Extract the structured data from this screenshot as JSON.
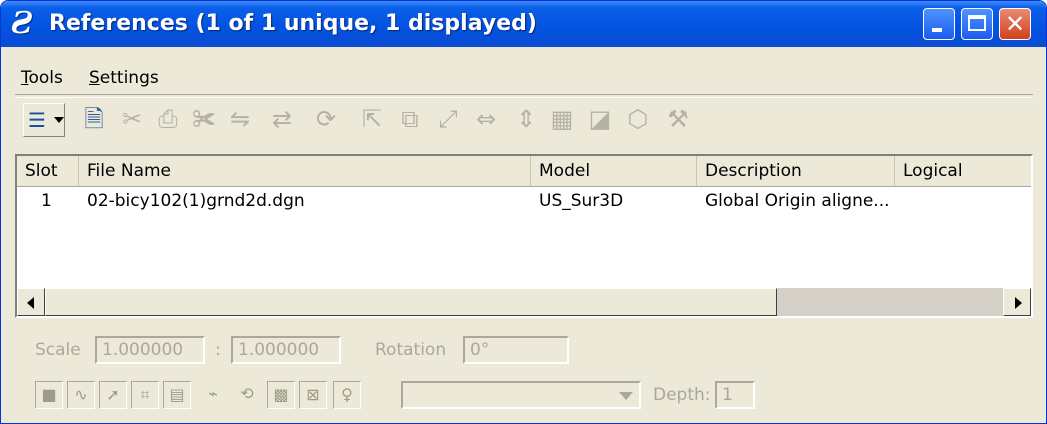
{
  "window": {
    "title": "References (1 of 1 unique, 1 displayed)",
    "app_icon_glyph": "Ƨ",
    "close_glyph": "✕"
  },
  "menu": {
    "items": [
      {
        "label": "Tools"
      },
      {
        "label": "Settings"
      }
    ]
  },
  "toolbar": {
    "list_icon_glyph": "☰",
    "tools": [
      {
        "name": "attach-icon",
        "glyph": "🗎",
        "enabled": true
      },
      {
        "name": "detach-icon",
        "glyph": "✂",
        "enabled": false
      },
      {
        "name": "print-icon",
        "glyph": "⎙",
        "enabled": false
      },
      {
        "name": "clip-icon",
        "glyph": "✀",
        "enabled": false
      },
      {
        "name": "reload-icon",
        "glyph": "⇋",
        "enabled": false
      },
      {
        "name": "exchange-icon",
        "glyph": "⇄",
        "enabled": false
      },
      {
        "name": "rotate-icon",
        "glyph": "⟳",
        "enabled": false
      },
      {
        "name": "move-icon",
        "glyph": "⇱",
        "enabled": false
      },
      {
        "name": "copy-icon",
        "glyph": "⧉",
        "enabled": false
      },
      {
        "name": "scale-icon",
        "glyph": "⤢",
        "enabled": false
      },
      {
        "name": "mirror-h-icon",
        "glyph": "⇔",
        "enabled": false
      },
      {
        "name": "mirror-v-icon",
        "glyph": "⇕",
        "enabled": false
      },
      {
        "name": "clip-boundary-icon",
        "glyph": "▦",
        "enabled": false
      },
      {
        "name": "clip-mask-icon",
        "glyph": "◪",
        "enabled": false
      },
      {
        "name": "set-icon",
        "glyph": "⬡",
        "enabled": false
      },
      {
        "name": "tools-icon",
        "glyph": "⚒",
        "enabled": false
      }
    ]
  },
  "table": {
    "columns": [
      "Slot",
      "File Name",
      "Model",
      "Description",
      "Logical"
    ],
    "rows": [
      {
        "slot": "1",
        "file_name": "02-bicy102(1)grnd2d.dgn",
        "model": "US_Sur3D",
        "description": "Global Origin aligne...",
        "logical": ""
      }
    ]
  },
  "scale": {
    "label": "Scale",
    "value1": "1.000000",
    "separator": ":",
    "value2": "1.000000",
    "rotation_label": "Rotation",
    "rotation_value": "0°"
  },
  "bottom_bar": {
    "icons": [
      {
        "name": "display-toggle-icon",
        "glyph": "■"
      },
      {
        "name": "snap-icon",
        "glyph": "∿"
      },
      {
        "name": "locate-icon",
        "glyph": "➚"
      },
      {
        "name": "treat-as-element-icon",
        "glyph": "⌗"
      },
      {
        "name": "level-icon",
        "glyph": "▤"
      },
      {
        "name": "nesting-icon",
        "glyph": "⌁"
      },
      {
        "name": "live-nesting-icon",
        "glyph": "⟲"
      },
      {
        "name": "raster-icon",
        "glyph": "▩"
      },
      {
        "name": "clip-icon",
        "glyph": "⊠"
      },
      {
        "name": "lightbulb-icon",
        "glyph": "♀"
      }
    ],
    "combo_value": "",
    "depth_label": "Depth:",
    "depth_value": "1"
  }
}
